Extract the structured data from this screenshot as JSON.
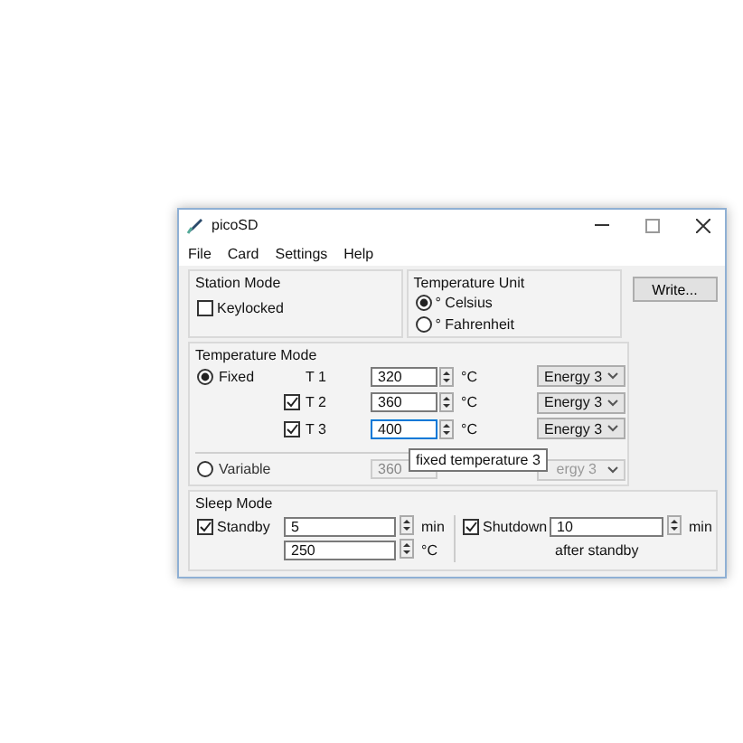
{
  "window": {
    "title": "picoSD"
  },
  "menu": [
    "File",
    "Card",
    "Settings",
    "Help"
  ],
  "station_mode": {
    "title": "Station Mode",
    "keylocked": {
      "label": "Keylocked",
      "checked": false
    }
  },
  "temperature_unit": {
    "title": "Temperature Unit",
    "options": [
      {
        "label": "° Celsius",
        "selected": true
      },
      {
        "label": "° Fahrenheit",
        "selected": false
      }
    ]
  },
  "write_button": "Write...",
  "temperature_mode": {
    "title": "Temperature Mode",
    "fixed": {
      "label": "Fixed",
      "selected": true
    },
    "rows": [
      {
        "kind": "plain",
        "label": "T 1",
        "value": "320",
        "unit": "°C",
        "energy": "Energy 3",
        "focused": false
      },
      {
        "kind": "check",
        "label": "T 2",
        "checked": true,
        "value": "360",
        "unit": "°C",
        "energy": "Energy 3",
        "focused": false
      },
      {
        "kind": "check",
        "label": "T 3",
        "checked": true,
        "value": "400",
        "unit": "°C",
        "energy": "Energy 3",
        "focused": true
      }
    ],
    "variable": {
      "label": "Variable",
      "selected": false,
      "disabled": true,
      "value": "360",
      "energy": "ergy 3"
    },
    "tooltip": "fixed temperature 3"
  },
  "sleep_mode": {
    "title": "Sleep Mode",
    "standby": {
      "label": "Standby",
      "checked": true,
      "minutes": "5",
      "minutes_unit": "min",
      "temperature": "250",
      "temperature_unit": "°C"
    },
    "shutdown": {
      "label": "Shutdown",
      "checked": true,
      "minutes": "10",
      "minutes_unit": "min",
      "note": "after standby"
    }
  }
}
